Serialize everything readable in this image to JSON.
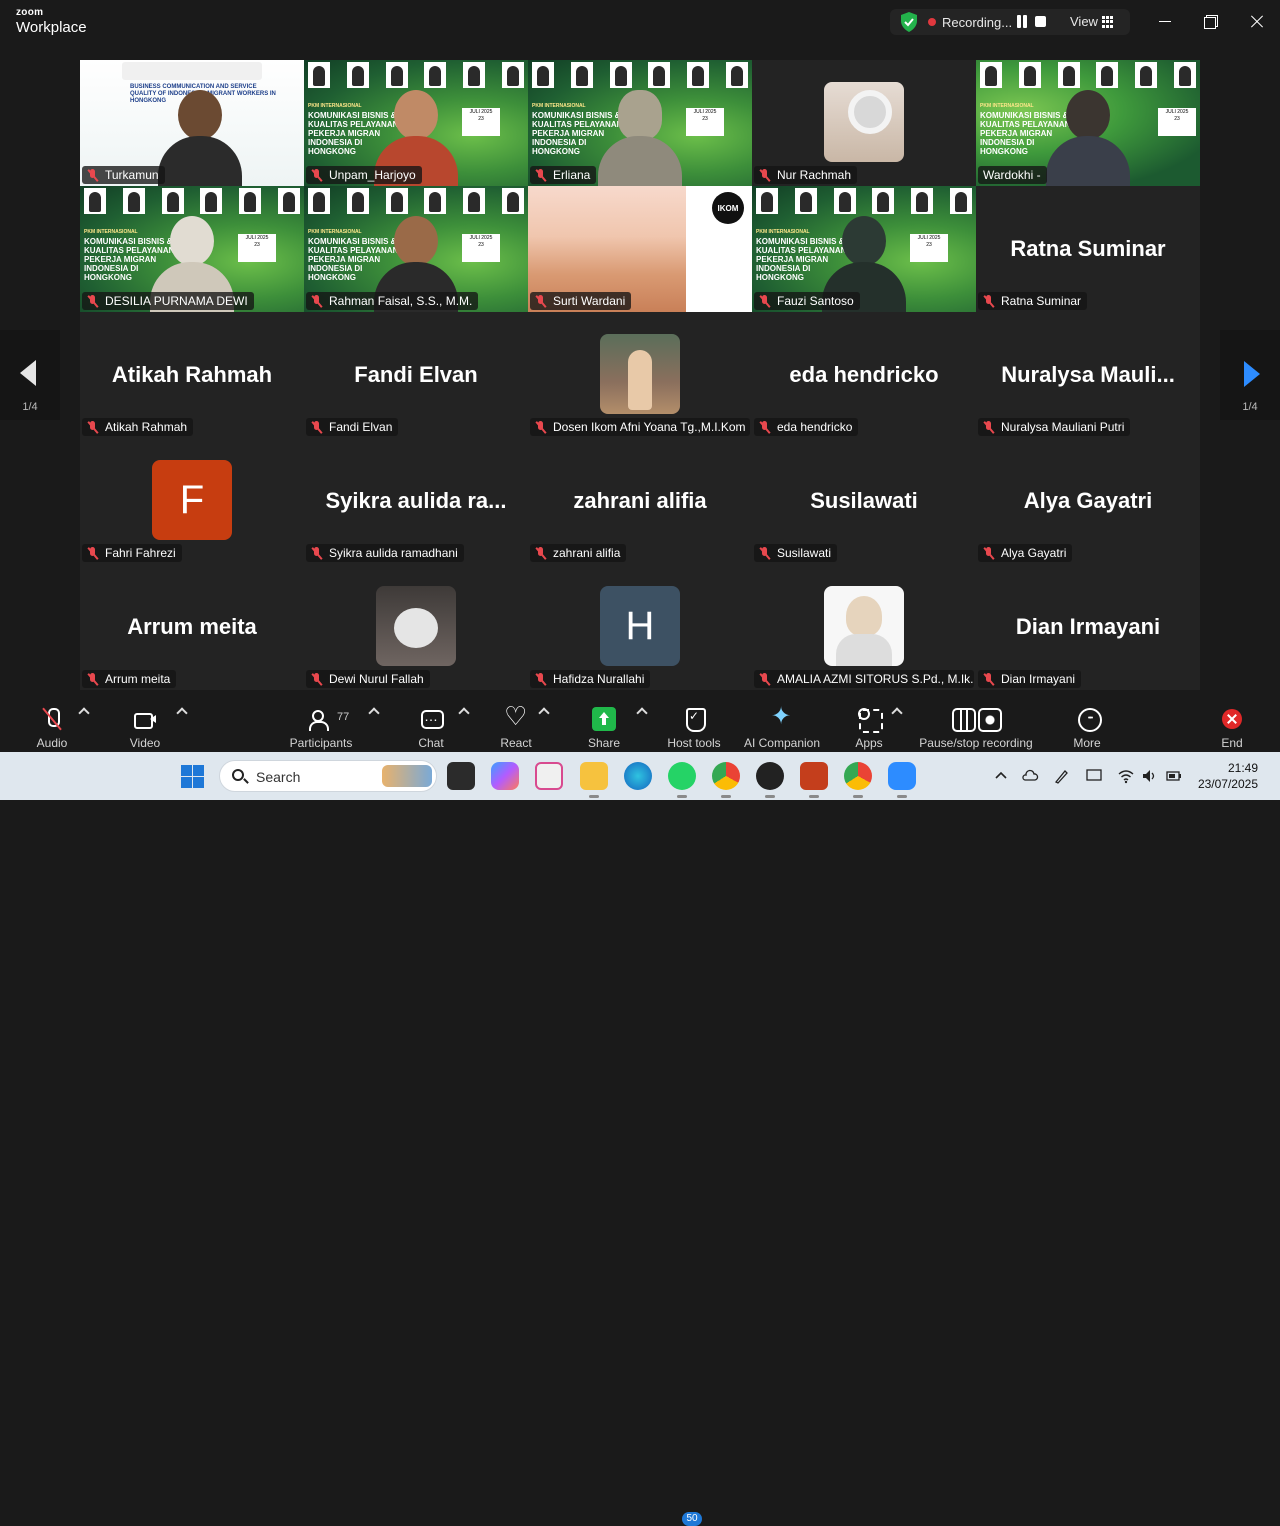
{
  "app": {
    "brand_top": "zoom",
    "brand_bottom": "Workplace"
  },
  "topbar": {
    "recording_label": "Recording...",
    "view_label": "View"
  },
  "gallery": {
    "tiles": [
      {
        "name": "Turkamun",
        "kind": "video"
      },
      {
        "name": "Unpam_Harjoyo",
        "kind": "video"
      },
      {
        "name": "Erliana",
        "kind": "video"
      },
      {
        "name": "Nur Rachmah",
        "kind": "photo"
      },
      {
        "name": "Wardokhi -",
        "kind": "video",
        "active": true
      },
      {
        "name": "DESILIA PURNAMA DEWI",
        "kind": "video"
      },
      {
        "name": "Rahman Faisal, S.S., M.M.",
        "kind": "video"
      },
      {
        "name": "Surti Wardani",
        "kind": "video"
      },
      {
        "name": "Fauzi Santoso",
        "kind": "video"
      },
      {
        "name": "Ratna Suminar",
        "display": "Ratna Suminar",
        "kind": "text"
      },
      {
        "name": "Atikah Rahmah",
        "display": "Atikah Rahmah",
        "kind": "text"
      },
      {
        "name": "Fandi Elvan",
        "display": "Fandi Elvan",
        "kind": "text"
      },
      {
        "name": "Dosen Ikom Afni Yoana Tg.,M.I.Kom",
        "kind": "photo"
      },
      {
        "name": "eda hendricko",
        "display": "eda hendricko",
        "kind": "text"
      },
      {
        "name": "Nuralysa Mauliani Putri",
        "display": "Nuralysa  Mauli...",
        "kind": "text"
      },
      {
        "name": "Fahri Fahrezi",
        "letter": "F",
        "kind": "letter"
      },
      {
        "name": "Syikra aulida ramadhani",
        "display": "Syikra  aulida  ra...",
        "kind": "text"
      },
      {
        "name": "zahrani alifia",
        "display": "zahrani alifia",
        "kind": "text"
      },
      {
        "name": "Susilawati",
        "display": "Susilawati",
        "kind": "text"
      },
      {
        "name": "Alya Gayatri",
        "display": "Alya Gayatri",
        "kind": "text"
      },
      {
        "name": "Arrum meita",
        "display": "Arrum meita",
        "kind": "text"
      },
      {
        "name": "Dewi Nurul Fallah",
        "kind": "photo"
      },
      {
        "name": "Hafidza Nurallahi",
        "letter": "H",
        "kind": "letter"
      },
      {
        "name": "AMALIA AZMI SITORUS S.Pd., M.Ik...",
        "kind": "photo"
      },
      {
        "name": "Dian Irmayani",
        "display": "Dian Irmayani",
        "kind": "text"
      }
    ],
    "poster": {
      "kicker": "PKM INTERNASIONAL",
      "title": "KOMUNIKASI BISNIS & KUALITAS PELAYANAN PEKERJA MIGRAN INDONESIA DI HONGKONG",
      "date": "JULI 2025",
      "day": "23",
      "time1": "08.00 PM (INDONESIA)",
      "time2": "09.00 PM (HONGKONG)"
    },
    "poster_en": "BUSINESS COMMUNICATION AND SERVICE QUALITY OF INDONESIAN MIGRANT WORKERS IN HONGKONG",
    "ikom_logo": "IKOM"
  },
  "pagination": {
    "left": "1/4",
    "right": "1/4"
  },
  "toolbar": {
    "audio": "Audio",
    "video": "Video",
    "participants": "Participants",
    "participants_count": "77",
    "chat": "Chat",
    "react": "React",
    "share": "Share",
    "host_tools": "Host tools",
    "ai_companion": "AI Companion",
    "apps": "Apps",
    "pause_stop_recording": "Pause/stop recording",
    "more": "More",
    "end": "End"
  },
  "taskbar": {
    "search_label": "Search",
    "whatsapp_badge": "50",
    "time": "21:49",
    "date": "23/07/2025"
  },
  "colors": {
    "active_speaker": "#2ccf4c",
    "end_button": "#e02828",
    "share_button": "#20b84a",
    "nav_arrow": "#2d8cff",
    "muted_mic": "#e8484e"
  }
}
